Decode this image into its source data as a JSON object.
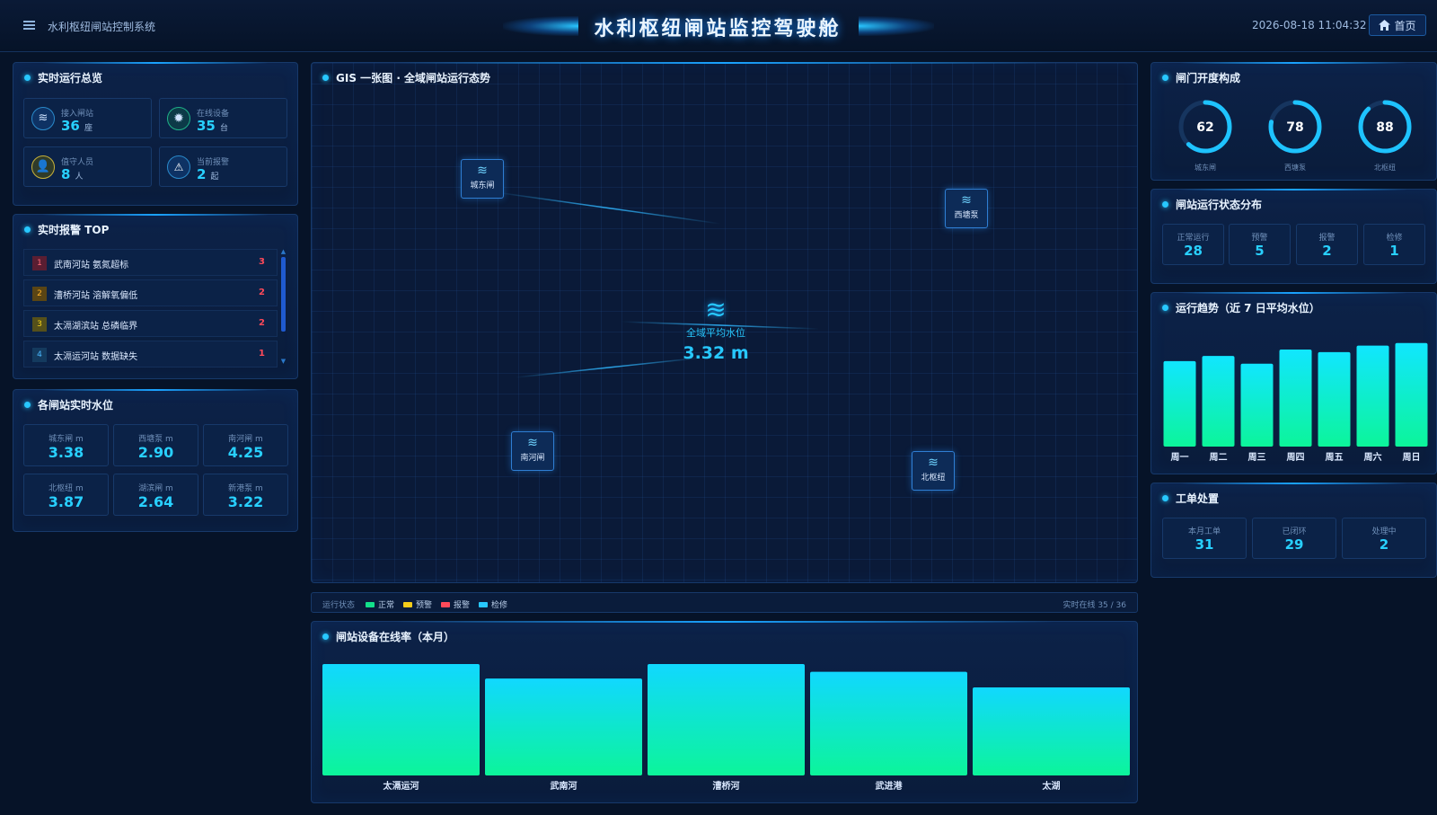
{
  "header": {
    "system_name": "水利枢纽闸站控制系统",
    "title": "水利枢纽闸站监控驾驶舱",
    "datetime": "2026-08-18 11:04:32",
    "home_label": "首页",
    "menu_icon": "menu-icon",
    "home_icon": "home-icon"
  },
  "overview": {
    "title": "实时运行总览",
    "cards": [
      {
        "label": "接入闸站",
        "value": "36",
        "unit": "座",
        "icon": "water-icon"
      },
      {
        "label": "在线设备",
        "value": "35",
        "unit": "台",
        "icon": "device-icon"
      },
      {
        "label": "值守人员",
        "value": "8",
        "unit": "人",
        "icon": "person-icon"
      },
      {
        "label": "当前报警",
        "value": "2",
        "unit": "起",
        "icon": "warning-icon"
      }
    ]
  },
  "alarms": {
    "title": "实时报警 TOP",
    "items": [
      {
        "rank": "1",
        "text": "武南河站 氨氮超标",
        "count": "3"
      },
      {
        "rank": "2",
        "text": "漕桥河站 溶解氧偏低",
        "count": "2"
      },
      {
        "rank": "3",
        "text": "太滆湖滨站 总磷临界",
        "count": "2"
      },
      {
        "rank": "4",
        "text": "太滆运河站 数据缺失",
        "count": "1"
      }
    ]
  },
  "levels": {
    "title": "各闸站实时水位",
    "items": [
      {
        "label": "城东闸 m",
        "value": "3.38"
      },
      {
        "label": "西塘泵 m",
        "value": "2.90"
      },
      {
        "label": "南河闸 m",
        "value": "4.25"
      },
      {
        "label": "北枢纽 m",
        "value": "3.87"
      },
      {
        "label": "湖滨闸 m",
        "value": "2.64"
      },
      {
        "label": "新港泵 m",
        "value": "3.22"
      }
    ]
  },
  "gis": {
    "title": "GIS 一张图 · 全域闸站运行态势",
    "center_label": "全域平均水位",
    "center_value": "3.32 m",
    "stations": [
      {
        "name": "城东闸"
      },
      {
        "name": "西塘泵"
      },
      {
        "name": "南河闸"
      },
      {
        "name": "北枢纽"
      }
    ]
  },
  "legend": {
    "label": "运行状态",
    "items": [
      {
        "name": "正常",
        "color": "#12e08a"
      },
      {
        "name": "预警",
        "color": "#f5cc1a"
      },
      {
        "name": "报警",
        "color": "#ff4a5a"
      },
      {
        "name": "检修",
        "color": "#27c8ff"
      }
    ],
    "online_text": "实时在线 35 / 36"
  },
  "gate_opening": {
    "title": "闸门开度构成",
    "items": [
      {
        "value": 62,
        "label": "城东闸"
      },
      {
        "value": 78,
        "label": "西塘泵"
      },
      {
        "value": 88,
        "label": "北枢纽"
      }
    ]
  },
  "status_dist": {
    "title": "闸站运行状态分布",
    "items": [
      {
        "label": "正常运行",
        "value": "28"
      },
      {
        "label": "预警",
        "value": "5"
      },
      {
        "label": "报警",
        "value": "2"
      },
      {
        "label": "检修",
        "value": "1"
      }
    ]
  },
  "work_orders": {
    "title": "工单处置",
    "items": [
      {
        "label": "本月工单",
        "value": "31"
      },
      {
        "label": "已闭环",
        "value": "29"
      },
      {
        "label": "处理中",
        "value": "2"
      }
    ]
  },
  "chart_data": [
    {
      "type": "bar",
      "title": "运行趋势（近 7 日平均水位）",
      "categories": [
        "周一",
        "周二",
        "周三",
        "周四",
        "周五",
        "周六",
        "周日"
      ],
      "values": [
        3.3,
        3.5,
        3.2,
        3.75,
        3.65,
        3.9,
        4.0
      ],
      "ylim": [
        0,
        4.2
      ],
      "grid": false,
      "colors": [
        "#11e6ff",
        "#0cf59a"
      ]
    },
    {
      "type": "bar",
      "title": "闸站设备在线率（本月）",
      "categories": [
        "太滆运河",
        "武南河",
        "漕桥河",
        "武进港",
        "太湖"
      ],
      "values": [
        100,
        87,
        100,
        93,
        79
      ],
      "ylim": [
        0,
        100
      ],
      "grid": false,
      "colors": [
        "#11d8ff",
        "#0cf59a"
      ]
    }
  ]
}
